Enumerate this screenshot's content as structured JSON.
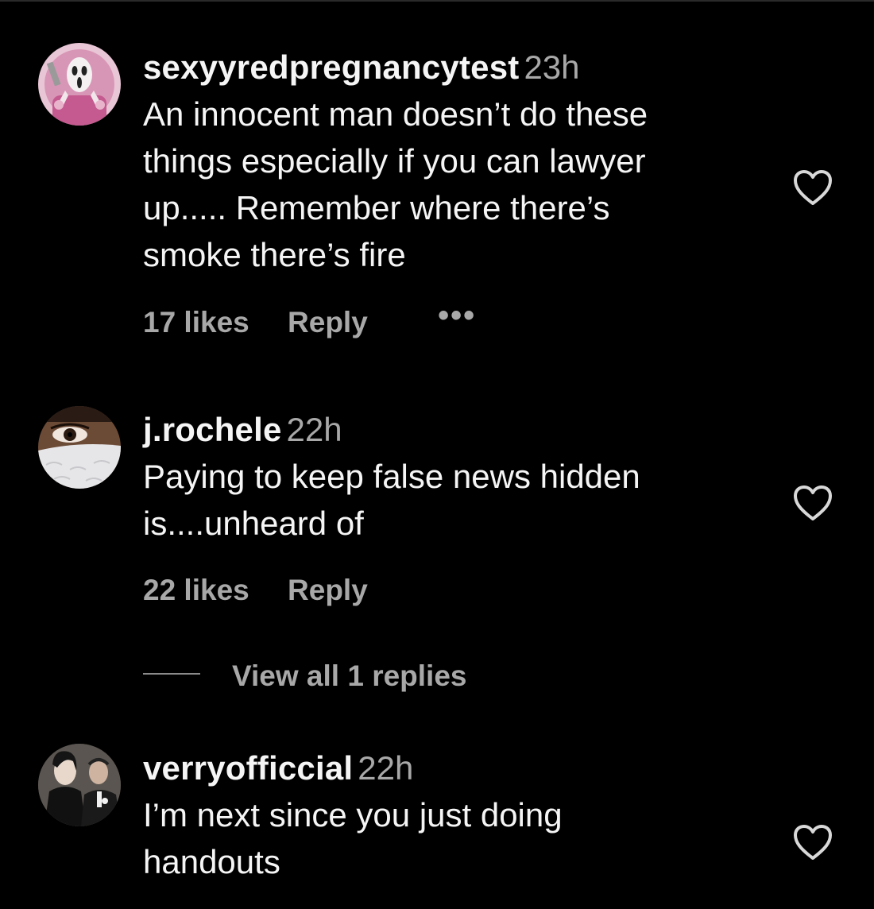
{
  "comments": [
    {
      "username": "sexyyredpregnancytest",
      "time": "23h",
      "text": "An innocent man doesn’t do these\nthings especially if you can lawyer\nup..... Remember where there’s\nsmoke there’s fire",
      "likes": "17 likes",
      "reply_label": "Reply",
      "more_label": "•••",
      "avatar_icon": "ghostface-pink-avatar",
      "like_icon": "heart-outline-icon"
    },
    {
      "username": "j.rochele",
      "time": "22h",
      "text": "Paying to keep false news hidden\nis....unheard of",
      "likes": "22 likes",
      "reply_label": "Reply",
      "view_replies_label": "View all 1 replies",
      "avatar_icon": "face-mask-avatar",
      "like_icon": "heart-outline-icon"
    },
    {
      "username": "verryofficcial",
      "time": "22h",
      "text": "I’m next since you just doing\nhandouts",
      "avatar_icon": "photo-avatar",
      "like_icon": "heart-outline-icon"
    }
  ],
  "colors": {
    "background": "#000000",
    "primary_text": "#f5f5f5",
    "secondary_text": "#a8a8a8"
  }
}
